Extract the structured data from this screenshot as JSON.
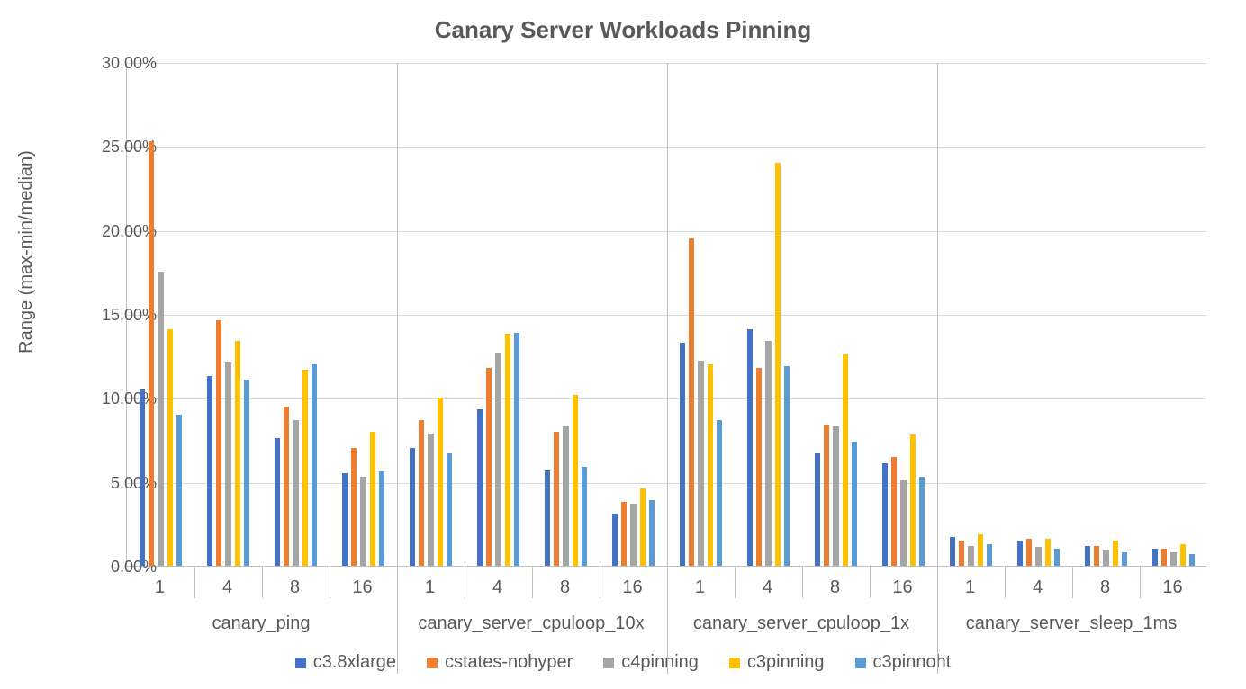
{
  "chart_data": {
    "type": "bar",
    "title": "Canary Server Workloads Pinning",
    "ylabel": "Range (max-min/median)",
    "xlabel": "",
    "ylim": [
      0,
      30
    ],
    "yticks": [
      0,
      5,
      10,
      15,
      20,
      25,
      30
    ],
    "ytick_labels": [
      "0.00%",
      "5.00%",
      "10.00%",
      "15.00%",
      "20.00%",
      "25.00%",
      "30.00%"
    ],
    "groups": [
      "canary_ping",
      "canary_server_cpuloop_10x",
      "canary_server_cpuloop_1x",
      "canary_server_sleep_1ms"
    ],
    "subgroups": [
      "1",
      "4",
      "8",
      "16"
    ],
    "series": [
      {
        "name": "c3.8xlarge",
        "color": "#4472C4"
      },
      {
        "name": "cstates-nohyper",
        "color": "#ED7D31"
      },
      {
        "name": "c4pinning",
        "color": "#A5A5A5"
      },
      {
        "name": "c3pinning",
        "color": "#FFC000"
      },
      {
        "name": "c3pinnoht",
        "color": "#5B9BD5"
      }
    ],
    "values": {
      "canary_ping": {
        "1": {
          "c3.8xlarge": 10.5,
          "cstates-nohyper": 25.3,
          "c4pinning": 17.5,
          "c3pinning": 14.1,
          "c3pinnoht": 9.0
        },
        "4": {
          "c3.8xlarge": 11.3,
          "cstates-nohyper": 14.6,
          "c4pinning": 12.1,
          "c3pinning": 13.4,
          "c3pinnoht": 11.1
        },
        "8": {
          "c3.8xlarge": 7.6,
          "cstates-nohyper": 9.5,
          "c4pinning": 8.7,
          "c3pinning": 11.7,
          "c3pinnoht": 12.0
        },
        "16": {
          "c3.8xlarge": 5.5,
          "cstates-nohyper": 7.0,
          "c4pinning": 5.3,
          "c3pinning": 8.0,
          "c3pinnoht": 5.6
        }
      },
      "canary_server_cpuloop_10x": {
        "1": {
          "c3.8xlarge": 7.0,
          "cstates-nohyper": 8.7,
          "c4pinning": 7.9,
          "c3pinning": 10.0,
          "c3pinnoht": 6.7
        },
        "4": {
          "c3.8xlarge": 9.3,
          "cstates-nohyper": 11.8,
          "c4pinning": 12.7,
          "c3pinning": 13.8,
          "c3pinnoht": 13.9
        },
        "8": {
          "c3.8xlarge": 5.7,
          "cstates-nohyper": 8.0,
          "c4pinning": 8.3,
          "c3pinning": 10.2,
          "c3pinnoht": 5.9
        },
        "16": {
          "c3.8xlarge": 3.1,
          "cstates-nohyper": 3.8,
          "c4pinning": 3.7,
          "c3pinning": 4.6,
          "c3pinnoht": 3.9
        }
      },
      "canary_server_cpuloop_1x": {
        "1": {
          "c3.8xlarge": 13.3,
          "cstates-nohyper": 19.5,
          "c4pinning": 12.2,
          "c3pinning": 12.0,
          "c3pinnoht": 8.7
        },
        "4": {
          "c3.8xlarge": 14.1,
          "cstates-nohyper": 11.8,
          "c4pinning": 13.4,
          "c3pinning": 24.0,
          "c3pinnoht": 11.9
        },
        "8": {
          "c3.8xlarge": 6.7,
          "cstates-nohyper": 8.4,
          "c4pinning": 8.3,
          "c3pinning": 12.6,
          "c3pinnoht": 7.4
        },
        "16": {
          "c3.8xlarge": 6.1,
          "cstates-nohyper": 6.5,
          "c4pinning": 5.1,
          "c3pinning": 7.8,
          "c3pinnoht": 5.3
        }
      },
      "canary_server_sleep_1ms": {
        "1": {
          "c3.8xlarge": 1.7,
          "cstates-nohyper": 1.5,
          "c4pinning": 1.2,
          "c3pinning": 1.9,
          "c3pinnoht": 1.3
        },
        "4": {
          "c3.8xlarge": 1.5,
          "cstates-nohyper": 1.6,
          "c4pinning": 1.1,
          "c3pinning": 1.6,
          "c3pinnoht": 1.0
        },
        "8": {
          "c3.8xlarge": 1.2,
          "cstates-nohyper": 1.2,
          "c4pinning": 0.9,
          "c3pinning": 1.5,
          "c3pinnoht": 0.8
        },
        "16": {
          "c3.8xlarge": 1.0,
          "cstates-nohyper": 1.0,
          "c4pinning": 0.8,
          "c3pinning": 1.3,
          "c3pinnoht": 0.7
        }
      }
    }
  }
}
